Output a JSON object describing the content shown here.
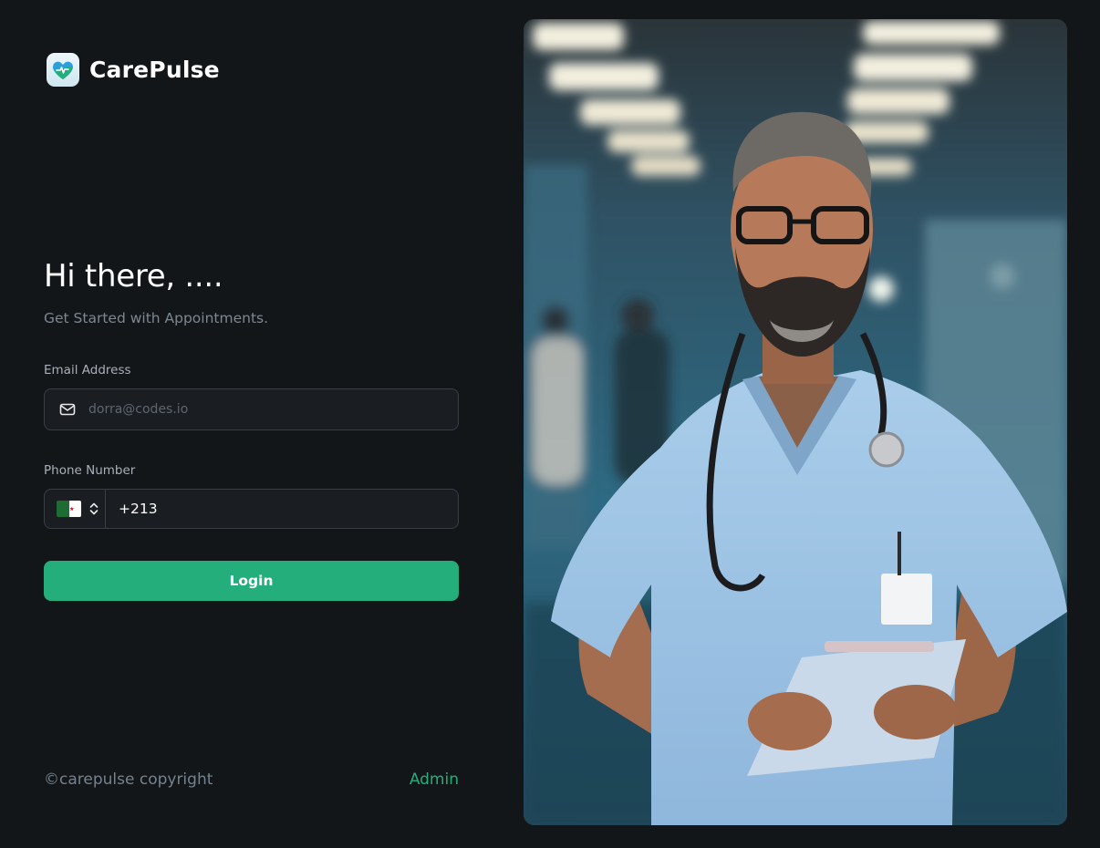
{
  "brand": {
    "name": "CarePulse",
    "logo_icon": "heart-pulse-logo-icon",
    "accent_color": "#24ae7c"
  },
  "hero": {
    "title": "Hi there, ....",
    "subtitle": "Get Started with Appointments."
  },
  "form": {
    "email": {
      "label": "Email Address",
      "placeholder": "dorra@codes.io",
      "value": "",
      "icon": "mail-icon"
    },
    "phone": {
      "label": "Phone Number",
      "country_flag": "algeria-flag-icon",
      "value": "+213"
    },
    "login_label": "Login"
  },
  "footer": {
    "copyright": "©carepulse copyright",
    "admin_label": "Admin"
  },
  "colors": {
    "background": "#131619",
    "input_background": "#1a1d21",
    "input_border": "#3a3f46",
    "primary_button": "#24ae7c"
  }
}
